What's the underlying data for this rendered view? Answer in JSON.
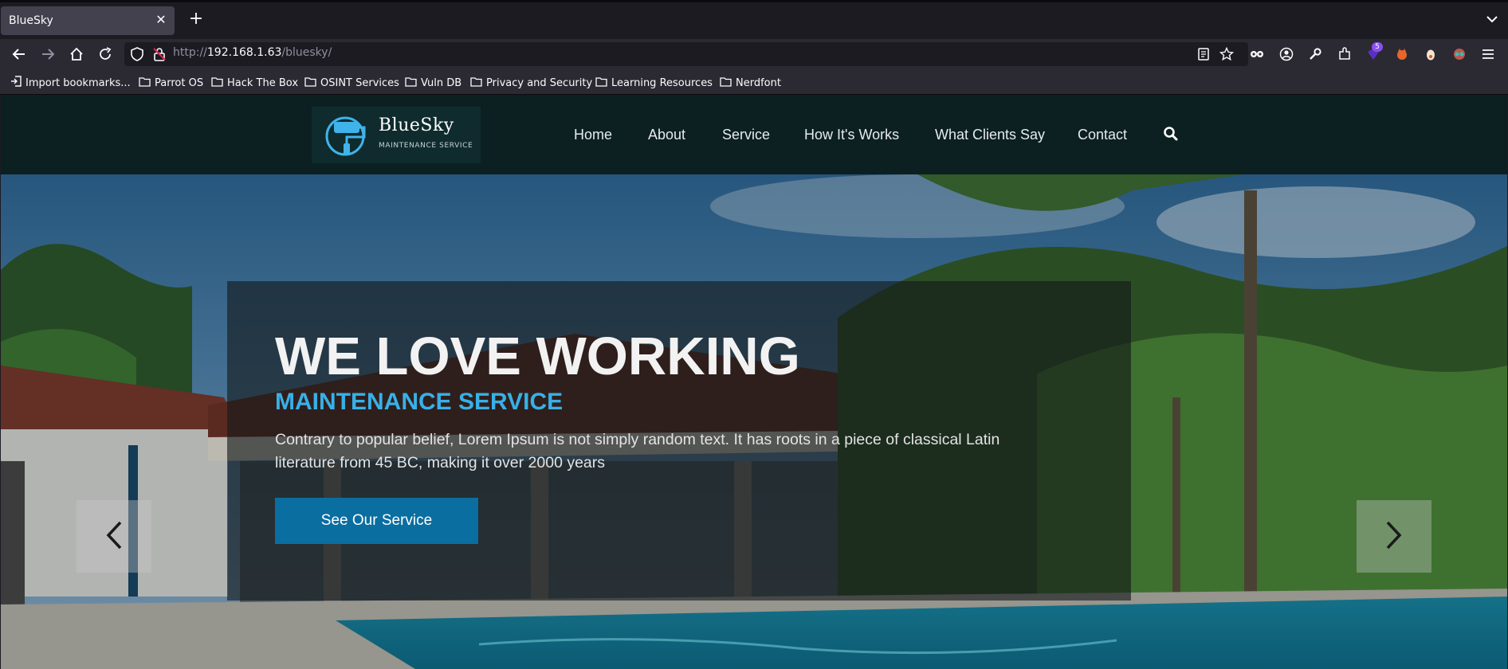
{
  "browser": {
    "tab_title": "BlueSky",
    "tab_close": "✕",
    "new_tab": "+",
    "url_prefix": "http://",
    "url_host": "192.168.1.63",
    "url_path": "/bluesky/",
    "extension_badge": "5"
  },
  "bookmarks": [
    {
      "label": "Import bookmarks...",
      "icon": "import-icon"
    },
    {
      "label": "Parrot OS",
      "icon": "folder-icon"
    },
    {
      "label": "Hack The Box",
      "icon": "folder-icon"
    },
    {
      "label": "OSINT Services",
      "icon": "folder-icon"
    },
    {
      "label": "Vuln DB",
      "icon": "folder-icon"
    },
    {
      "label": "Privacy and Security",
      "icon": "folder-icon"
    },
    {
      "label": "Learning Resources",
      "icon": "folder-icon"
    },
    {
      "label": "Nerdfont",
      "icon": "folder-icon"
    }
  ],
  "site": {
    "logo": {
      "name": "BlueSky",
      "tagline": "MAINTENANCE SERVICE"
    },
    "menu": [
      "Home",
      "About",
      "Service",
      "How It's Works",
      "What Clients Say",
      "Contact"
    ],
    "hero": {
      "title": "WE LOVE WORKING",
      "subtitle": "MAINTENANCE SERVICE",
      "text": "Contrary to popular belief, Lorem Ipsum is not simply random text. It has roots in a piece of classical Latin literature from 45 BC, making it over 2000 years",
      "button": "See Our Service"
    }
  },
  "colors": {
    "header_bg": "#0c1f21",
    "accent_blue": "#38b0e8",
    "button_blue": "#0a6ea1"
  }
}
